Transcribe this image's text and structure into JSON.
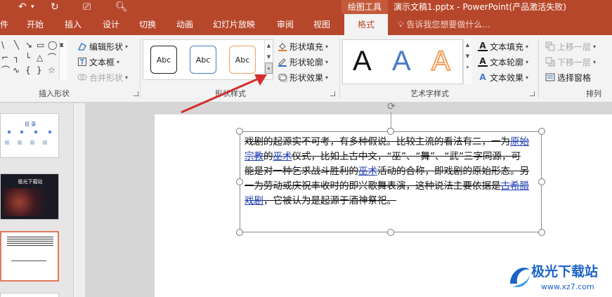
{
  "titlebar": {
    "ctx_group": "绘图工具",
    "doc_title": "演示文稿1.pptx - PowerPoint(产品激活失败)",
    "qa_undo": "↶",
    "qa_redo": "↻",
    "qa_present": "⎚",
    "qa_preview": "🔍︎"
  },
  "tabs": [
    "件",
    "开始",
    "插入",
    "设计",
    "切换",
    "动画",
    "幻灯片放映",
    "审阅",
    "视图",
    "格式"
  ],
  "tell_me": "告诉我您想要做什么...",
  "ribbon": {
    "insert_shapes": {
      "edit_shape": "编辑形状",
      "text_box": "文本框",
      "merge_shapes": "合并形状",
      "label": "插入形状"
    },
    "shape_styles": {
      "swatches": [
        "Abc",
        "Abc",
        "Abc"
      ],
      "fill": "形状填充",
      "outline": "形状轮廓",
      "effects": "形状效果",
      "label": "形状样式"
    },
    "wordart": {
      "samples": [
        "A",
        "A",
        "A"
      ],
      "text_fill": "文本填充",
      "text_outline": "文本轮廓",
      "text_effects": "文本效果",
      "label": "艺术字样式"
    },
    "arrange": {
      "bring_forward": "上移一层",
      "send_backward": "下移一层",
      "selection_pane": "选择窗格",
      "label": "排列"
    }
  },
  "thumbnails": [
    {
      "title": "目   录"
    },
    {
      "title": "极光下载站"
    },
    {
      "title": ""
    }
  ],
  "slide": {
    "para_1": "戏剧的起源实不可考，有多种假说。比较主流的看法有二，一为",
    "link_1": "原始宗教",
    "para_2": "的",
    "link_2": "巫术",
    "para_3": "仪式，比如上古中文，“巫”、“舞”、“武”三字同源，可能是对一种乞求战斗胜利的",
    "link_3": "巫术",
    "para_4": "活动的合称，即戏剧的原始形态。另一为劳动或庆祝丰收时的即兴歌舞表演，这种说法主要依据是",
    "link_4": "古希腊戏剧",
    "para_5": "，它被认为是起源于酒神祭祀。"
  },
  "watermark": {
    "title": "极光下载站",
    "url": "www.xz7.com"
  },
  "colors": {
    "accent": "#b7472a",
    "link": "#1f3fb0",
    "arrow": "#d32f2f",
    "wordart_blue": "#4a7ac9",
    "wordart_orange": "#f0a060"
  }
}
